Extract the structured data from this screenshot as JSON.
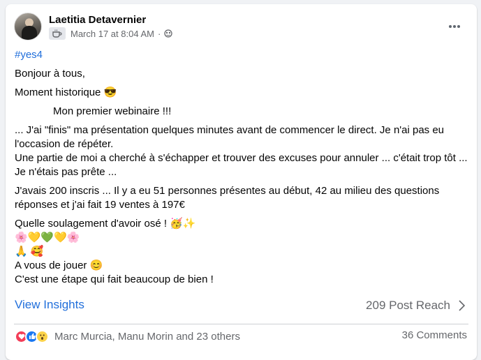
{
  "post": {
    "author": "Laetitia Detavernier",
    "date": "March 17 at 8:04 AM",
    "separator": "·",
    "hashtag": "#yes4",
    "lines": {
      "greeting": "Bonjour à tous,",
      "moment": "Moment historique 😎",
      "webinar": "Mon premier webinaire !!!",
      "para1a": "... J'ai \"finis\" ma présentation quelques minutes avant de commencer le direct. Je n'ai pas eu l'occasion de répéter.",
      "para1b": "Une partie de moi a cherché à s'échapper et trouver des excuses pour annuler ... c'était trop tôt ... Je n'étais pas prête ...",
      "para2": "J'avais 200 inscris ... Il y a eu 51 personnes présentes au début,  42 au milieu des questions réponses et j'ai fait 19 ventes à 197€",
      "relief": "Quelle soulagement d'avoir osé ! 🥳✨",
      "hearts": "🌸💛💚💛🌸",
      "pray": "🙏 🥰",
      "your_turn": "A vous de jouer 😊",
      "good": "C'est une étape qui fait beaucoup de bien !"
    }
  },
  "insights": {
    "link_label": "View Insights",
    "reach": "209 Post Reach"
  },
  "footer": {
    "reaction_names": "Marc Murcia, Manu Morin and 23 others",
    "comments": "36 Comments",
    "reaction_types": [
      "love",
      "like",
      "wow"
    ]
  },
  "colors": {
    "link": "#216fdb",
    "muted": "#65676b",
    "like": "#1877f2",
    "love": "#f33e58",
    "wow": "#fcd34a"
  }
}
